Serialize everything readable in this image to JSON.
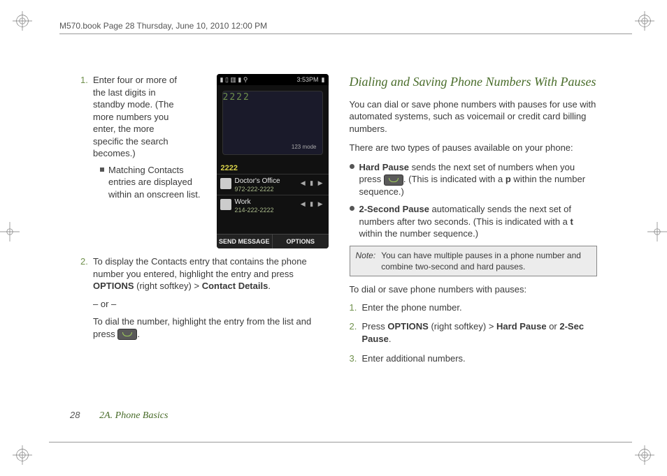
{
  "header": "M570.book  Page 28  Thursday, June 10, 2010  12:00 PM",
  "left": {
    "step1": "Enter four or more of the last digits in standby mode. (The more numbers you enter, the more specific the search becomes.)",
    "step1_sub": "Matching Contacts entries are displayed within an onscreen list.",
    "step2_a": "To display the Contacts entry that contains the phone number you entered, highlight the entry and press ",
    "step2_opt": "OPTIONS",
    "step2_b": " (right softkey) > ",
    "step2_cd": "Contact Details",
    "step2_c": ".",
    "or": "– or –",
    "step2_d": "To dial the number, highlight the entry from the list and press ",
    "step2_e": "."
  },
  "phone": {
    "time": "3:53PM",
    "status_left": "▮ ▯ ▥ ▮ ⚲",
    "batt": "▮",
    "dial": "2222",
    "mode": "123 mode",
    "query": "2222",
    "c1_name": "Doctor's Office",
    "c1_num": "972-222-2222",
    "c2_name": "Work",
    "c2_num": "214-222-2222",
    "soft_left": "SEND MESSAGE",
    "soft_right": "OPTIONS"
  },
  "right": {
    "h2": "Dialing and Saving Phone Numbers With Pauses",
    "p1": "You can dial or save phone numbers with pauses for use with automated systems, such as voicemail or credit card billing numbers.",
    "p2": "There are two types of pauses available on your phone:",
    "b1_lbl": "Hard Pause",
    "b1_a": " sends the next set of numbers when you press ",
    "b1_b": ". (This is indicated with a ",
    "b1_p": "p",
    "b1_c": " within the number sequence.)",
    "b2_lbl": "2-Second Pause",
    "b2_a": " automatically sends the next set of numbers after two seconds. (This is indicated with a ",
    "b2_t": "t",
    "b2_b": " within the number sequence.)",
    "note_lbl": "Note:",
    "note": "You can have multiple pauses in a phone number and combine two-second and hard pauses.",
    "lead": "To dial or save phone numbers with pauses:",
    "s1": "Enter the phone number.",
    "s2_a": "Press ",
    "s2_opt": "OPTIONS",
    "s2_b": " (right softkey) > ",
    "s2_hp": "Hard Pause",
    "s2_c": " or ",
    "s2_2s": "2-Sec Pause",
    "s2_d": ".",
    "s3": "Enter additional numbers."
  },
  "footer": {
    "page": "28",
    "section": "2A. Phone Basics"
  }
}
